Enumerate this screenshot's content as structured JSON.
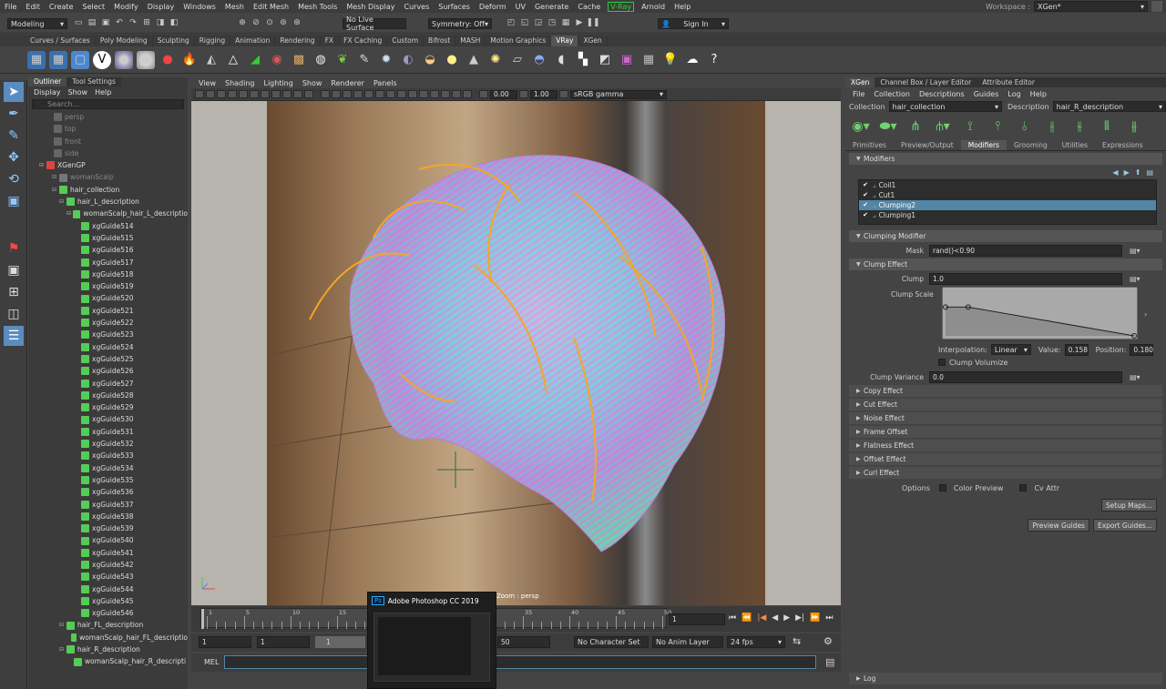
{
  "menubar": {
    "items": [
      "File",
      "Edit",
      "Create",
      "Select",
      "Modify",
      "Display",
      "Windows",
      "Mesh",
      "Edit Mesh",
      "Mesh Tools",
      "Mesh Display",
      "Curves",
      "Surfaces",
      "Deform",
      "UV",
      "Generate",
      "Cache"
    ],
    "vray": "V-Ray",
    "items_after": [
      "Arnold",
      "Help"
    ],
    "workspace_label": "Workspace :",
    "workspace_value": "XGen*"
  },
  "statusline": {
    "mode": "Modeling",
    "live_surface": "No Live Surface",
    "symmetry": "Symmetry: Off",
    "sign_in": "Sign In"
  },
  "shelf": {
    "tabs": [
      "Curves / Surfaces",
      "Poly Modeling",
      "Sculpting",
      "Rigging",
      "Animation",
      "Rendering",
      "FX",
      "FX Caching",
      "Custom",
      "Bifrost",
      "MASH",
      "Motion Graphics",
      "VRay",
      "XGen"
    ],
    "active_tab": "VRay"
  },
  "outliner": {
    "tabs": [
      "Outliner",
      "Tool Settings"
    ],
    "menu": [
      "Display",
      "Show",
      "Help"
    ],
    "search_placeholder": "Search...",
    "cameras": [
      "persp",
      "top",
      "front",
      "side"
    ],
    "xgen_gp": "XGenGP",
    "woman_scalp": "womanScalp",
    "hair_collection": "hair_collection",
    "hair_l_description": "hair_L_description",
    "woman_scalp_hair_l": "womanScalp_hair_L_descriptio",
    "guides": [
      "xgGuide514",
      "xgGuide515",
      "xgGuide516",
      "xgGuide517",
      "xgGuide518",
      "xgGuide519",
      "xgGuide520",
      "xgGuide521",
      "xgGuide522",
      "xgGuide523",
      "xgGuide524",
      "xgGuide525",
      "xgGuide526",
      "xgGuide527",
      "xgGuide528",
      "xgGuide529",
      "xgGuide530",
      "xgGuide531",
      "xgGuide532",
      "xgGuide533",
      "xgGuide534",
      "xgGuide535",
      "xgGuide536",
      "xgGuide537",
      "xgGuide538",
      "xgGuide539",
      "xgGuide540",
      "xgGuide541",
      "xgGuide542",
      "xgGuide543",
      "xgGuide544",
      "xgGuide545",
      "xgGuide546"
    ],
    "hair_fl_description": "hair_FL_description",
    "woman_scalp_hair_fl": "womanScalp_hair_FL_descriptio",
    "hair_r_description": "hair_R_description",
    "woman_scalp_hair_r": "womanScalp_hair_R_descripti"
  },
  "viewport": {
    "menu": [
      "View",
      "Shading",
      "Lighting",
      "Show",
      "Renderer",
      "Panels"
    ],
    "exposure": "0.00",
    "gamma": "1.00",
    "color_space": "sRGB gamma",
    "hud_label": "iZoom : persp"
  },
  "timeline": {
    "ticks": [
      "1",
      "5",
      "10",
      "15",
      "20",
      "25",
      "30",
      "35",
      "40",
      "45",
      "50"
    ],
    "current_frame": "1",
    "range_start": "1",
    "range_start2": "1",
    "range_inner": "1",
    "range_end": "50",
    "character_set": "No Character Set",
    "anim_layer": "No Anim Layer",
    "fps": "24 fps",
    "mel_label": "MEL"
  },
  "taskbar_popup": {
    "title": "Adobe Photoshop CC 2019"
  },
  "xgen": {
    "tabs": [
      "XGen",
      "Channel Box / Layer Editor",
      "Attribute Editor"
    ],
    "menu": [
      "File",
      "Collection",
      "Descriptions",
      "Guides",
      "Log",
      "Help"
    ],
    "collection_label": "Collection",
    "collection_value": "hair_collection",
    "description_label": "Description",
    "description_value": "hair_R_description",
    "subtabs": [
      "Primitives",
      "Preview/Output",
      "Modifiers",
      "Grooming",
      "Utilities",
      "Expressions"
    ],
    "active_subtab": "Modifiers",
    "modifiers_header": "Modifiers",
    "modifiers": [
      {
        "name": "Coil1",
        "checked": true,
        "selected": false
      },
      {
        "name": "Cut1",
        "checked": true,
        "selected": false
      },
      {
        "name": "Clumping2",
        "checked": true,
        "selected": true
      },
      {
        "name": "Clumping1",
        "checked": true,
        "selected": false
      }
    ],
    "clumping_header": "Clumping Modifier",
    "mask_label": "Mask",
    "mask_value": "rand()<0.90",
    "clump_effect_header": "Clump Effect",
    "clump_label": "Clump",
    "clump_value": "1.0",
    "clump_scale_label": "Clump Scale",
    "ramp_points": [
      {
        "pos": 0.0,
        "value": 0.158
      },
      {
        "pos": 0.12,
        "value": 0.158
      },
      {
        "pos": 1.0,
        "value": 0.0
      }
    ],
    "interpolation_label": "Interpolation:",
    "interpolation_value": "Linear",
    "value_label": "Value:",
    "value_value": "0.158",
    "position_label": "Position:",
    "position_value": "0.180",
    "clump_volumize": "Clump Volumize",
    "clump_variance_label": "Clump Variance",
    "clump_variance_value": "0.0",
    "collapsed_sections": [
      "Copy Effect",
      "Cut Effect",
      "Noise Effect",
      "Frame Offset",
      "Flatness Effect",
      "Offset Effect",
      "Curl Effect"
    ],
    "options_label": "Options",
    "color_preview": "Color Preview",
    "cv_attr": "Cv Attr",
    "setup_maps": "Setup Maps...",
    "preview_guides": "Preview Guides",
    "export_guides": "Export Guides...",
    "log_header": "Log"
  },
  "colors": {
    "accent_select": "#5285a6",
    "vray_green": "#2ecc40",
    "xgen_green": "#6fd36f"
  }
}
